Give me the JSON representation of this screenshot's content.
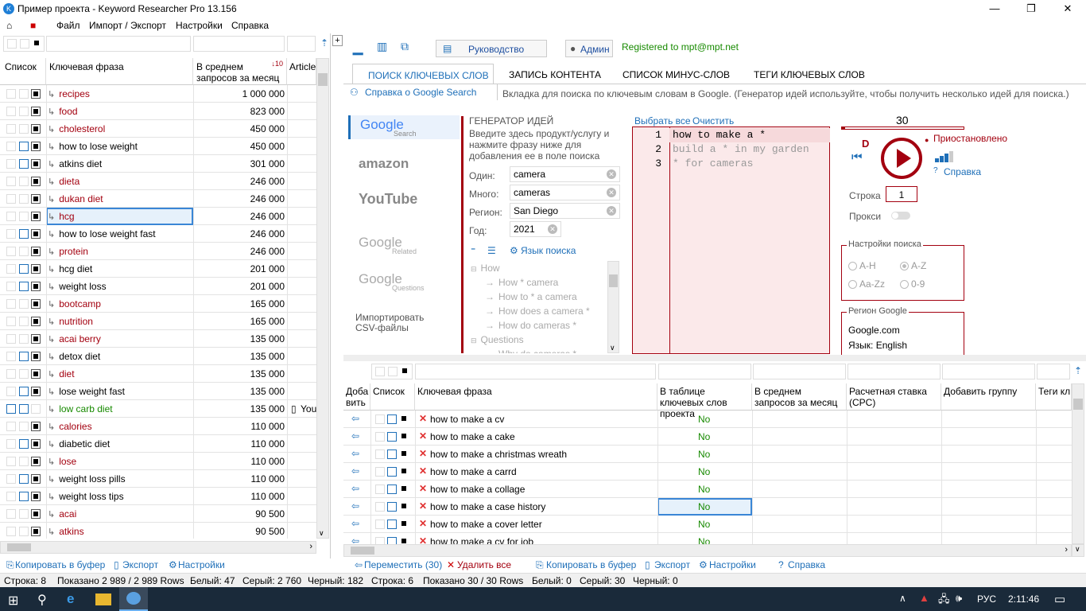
{
  "window": {
    "title": "Пример проекта - Keyword Researcher Pro 13.156",
    "icon": "app-icon"
  },
  "menu": [
    "Файл",
    "Импорт / Экспорт",
    "Настройки",
    "Справка"
  ],
  "left": {
    "headers": {
      "list": "Список",
      "phrase": "Ключевая фраза",
      "avg": "В среднем запросов за месяц",
      "article": "Article"
    },
    "sort_badge": "10",
    "rows": [
      {
        "kw": "recipes",
        "v": "1 000 000",
        "c": "red"
      },
      {
        "kw": "food",
        "v": "823 000",
        "c": "red"
      },
      {
        "kw": "cholesterol",
        "v": "450 000",
        "c": "red"
      },
      {
        "kw": "how to lose weight",
        "v": "450 000",
        "c": ""
      },
      {
        "kw": "atkins diet",
        "v": "301 000",
        "c": ""
      },
      {
        "kw": "dieta",
        "v": "246 000",
        "c": "red"
      },
      {
        "kw": "dukan diet",
        "v": "246 000",
        "c": "red"
      },
      {
        "kw": "hcg",
        "v": "246 000",
        "c": "red"
      },
      {
        "kw": "how to lose weight fast",
        "v": "246 000",
        "c": ""
      },
      {
        "kw": "protein",
        "v": "246 000",
        "c": "red"
      },
      {
        "kw": "hcg diet",
        "v": "201 000",
        "c": ""
      },
      {
        "kw": "weight loss",
        "v": "201 000",
        "c": ""
      },
      {
        "kw": "bootcamp",
        "v": "165 000",
        "c": "red"
      },
      {
        "kw": "nutrition",
        "v": "165 000",
        "c": "red"
      },
      {
        "kw": "acai berry",
        "v": "135 000",
        "c": "red"
      },
      {
        "kw": "detox diet",
        "v": "135 000",
        "c": ""
      },
      {
        "kw": "diet",
        "v": "135 000",
        "c": "red"
      },
      {
        "kw": "lose weight fast",
        "v": "135 000",
        "c": ""
      },
      {
        "kw": "low carb diet",
        "v": "135 000",
        "c": "grn",
        "art": "You"
      },
      {
        "kw": "calories",
        "v": "110 000",
        "c": "red"
      },
      {
        "kw": "diabetic diet",
        "v": "110 000",
        "c": ""
      },
      {
        "kw": "lose",
        "v": "110 000",
        "c": "red"
      },
      {
        "kw": "weight loss pills",
        "v": "110 000",
        "c": ""
      },
      {
        "kw": "weight loss tips",
        "v": "110 000",
        "c": ""
      },
      {
        "kw": "acai",
        "v": "90 500",
        "c": "red"
      },
      {
        "kw": "atkins",
        "v": "90 500",
        "c": "red"
      }
    ],
    "footer": {
      "copy": "Копировать в буфер",
      "export": "Экспорт",
      "settings": "Настройки"
    }
  },
  "toolbar": {
    "guide": "Руководство",
    "admin": "Админ",
    "registered": "Registered to mpt@mpt.net"
  },
  "tabs": [
    "ПОИСК КЛЮЧЕВЫХ СЛОВ",
    "ЗАПИСЬ КОНТЕНТА",
    "СПИСОК МИНУС-СЛОВ",
    "ТЕГИ КЛЮЧЕВЫХ СЛОВ"
  ],
  "help_link": "Справка о Google Search",
  "help_hint": "Вкладка для поиска по ключевым словам в Google. (Генератор идей используйте, чтобы получить несколько идей для поиска.)",
  "sources": {
    "google_sub": "Search",
    "related_sub": "Related",
    "questions_sub": "Questions",
    "import": "Импортировать CSV-файлы"
  },
  "generator": {
    "title": "ГЕНЕРАТОР ИДЕЙ",
    "desc": "Введите здесь продукт/услугу и нажмите фразу ниже для добавления ее в поле поиска",
    "one_label": "Один:",
    "one": "camera",
    "many_label": "Много:",
    "many": "cameras",
    "region_label": "Регион:",
    "region": "San Diego",
    "year_label": "Год:",
    "year": "2021",
    "lang": "Язык поиска",
    "tree": [
      "How",
      "How * camera",
      "How to * a camera",
      "How does a camera *",
      "How do cameras *",
      "Questions",
      "Why do cameras *"
    ]
  },
  "editor": {
    "select_all": "Выбрать все",
    "clear": "Очистить",
    "lines": [
      "how to make a *",
      "build a * in my garden",
      "* for cameras"
    ]
  },
  "control": {
    "count": "30",
    "d": "D",
    "status": "Приостановлено",
    "help": "Справка",
    "row_label": "Строка",
    "row": "1",
    "proxy": "Прокси",
    "settings_title": "Настройки поиска",
    "opts": [
      "A-H",
      "A-Z",
      "Aa-Zz",
      "0-9"
    ],
    "region_title": "Регион Google",
    "region_domain": "Google.com",
    "region_lang": "Язык: English"
  },
  "bottom": {
    "headers": {
      "add": "Доба вить",
      "list": "Список",
      "phrase": "Ключевая фраза",
      "in_table": "В таблице ключевых слов проекта",
      "avg": "В среднем запросов за месяц",
      "cpc": "Расчетная ставка (CPC)",
      "group": "Добавить группу",
      "tags": "Теги кл"
    },
    "rows": [
      {
        "kw": "how to make a cv",
        "v": "No"
      },
      {
        "kw": "how to make a cake",
        "v": "No"
      },
      {
        "kw": "how to make a christmas wreath",
        "v": "No"
      },
      {
        "kw": "how to make a carrd",
        "v": "No"
      },
      {
        "kw": "how to make a collage",
        "v": "No"
      },
      {
        "kw": "how to make a case history",
        "v": "No"
      },
      {
        "kw": "how to make a cover letter",
        "v": "No"
      },
      {
        "kw": "how to make a cv for job",
        "v": "No"
      }
    ],
    "footer": {
      "move": "Переместить (30)",
      "delete": "Удалить все",
      "copy": "Копировать в буфер",
      "export": "Экспорт",
      "settings": "Настройки",
      "help": "Справка"
    }
  },
  "status": {
    "row": "Строка: 8",
    "shown": "Показано 2 989 / 2 989 Rows",
    "white": "Белый: 47",
    "gray": "Серый: 2 760",
    "black": "Черный: 182",
    "row2": "Строка: 6",
    "shown2": "Показано 30 / 30 Rows",
    "white2": "Белый: 0",
    "gray2": "Серый: 30",
    "black2": "Черный: 0"
  },
  "taskbar": {
    "lang": "РУС",
    "time": "2:11:46"
  }
}
